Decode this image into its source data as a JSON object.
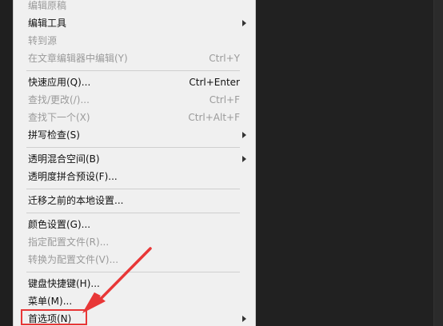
{
  "menu": {
    "items": [
      {
        "label": "编辑原稿",
        "enabled": false
      },
      {
        "label": "编辑工具",
        "enabled": true,
        "submenu": true
      },
      {
        "label": "转到源",
        "enabled": false
      },
      {
        "label": "在文章编辑器中编辑(Y)",
        "shortcut": "Ctrl+Y",
        "enabled": false
      },
      {
        "label": "快速应用(Q)...",
        "shortcut": "Ctrl+Enter",
        "enabled": true
      },
      {
        "label": "查找/更改(/)...",
        "shortcut": "Ctrl+F",
        "enabled": false
      },
      {
        "label": "查找下一个(X)",
        "shortcut": "Ctrl+Alt+F",
        "enabled": false
      },
      {
        "label": "拼写检查(S)",
        "enabled": true,
        "submenu": true
      },
      {
        "label": "透明混合空间(B)",
        "enabled": true,
        "submenu": true
      },
      {
        "label": "透明度拼合预设(F)...",
        "enabled": true
      },
      {
        "label": "迁移之前的本地设置...",
        "enabled": true
      },
      {
        "label": "颜色设置(G)...",
        "enabled": true
      },
      {
        "label": "指定配置文件(R)...",
        "enabled": false
      },
      {
        "label": "转换为配置文件(V)...",
        "enabled": false
      },
      {
        "label": "键盘快捷键(H)...",
        "enabled": true
      },
      {
        "label": "菜单(M)...",
        "enabled": true
      },
      {
        "label": "首选项(N)",
        "enabled": true,
        "submenu": true,
        "highlighted": true
      }
    ]
  },
  "annotation": {
    "color": "#e83737"
  }
}
